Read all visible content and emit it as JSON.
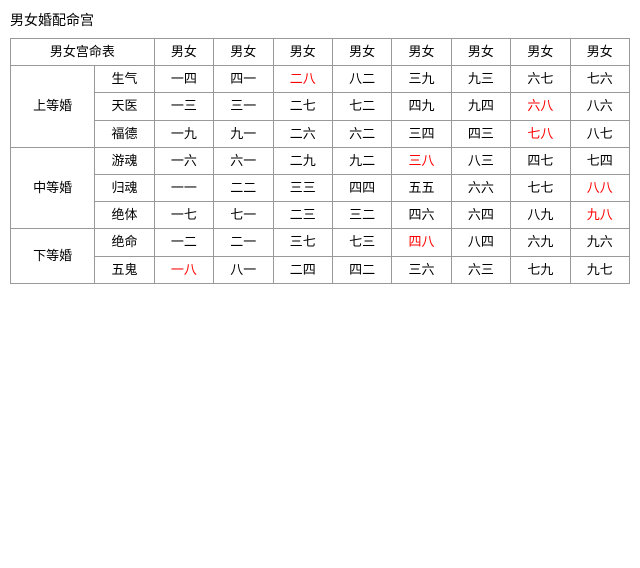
{
  "title": "男女婚配命宫",
  "header": {
    "col0": "男女宫命表",
    "cols": [
      "男女",
      "男女",
      "男女",
      "男女",
      "男女",
      "男女",
      "男女",
      "男女"
    ]
  },
  "groups": [
    {
      "grade": "上等婚",
      "rows": [
        {
          "subtype": "生气",
          "cells": [
            {
              "text": "一四",
              "red": false
            },
            {
              "text": "四一",
              "red": false
            },
            {
              "text": "二八",
              "red": true
            },
            {
              "text": "八二",
              "red": false
            },
            {
              "text": "三九",
              "red": false
            },
            {
              "text": "九三",
              "red": false
            },
            {
              "text": "六七",
              "red": false
            },
            {
              "text": "七六",
              "red": false
            }
          ]
        },
        {
          "subtype": "天医",
          "cells": [
            {
              "text": "一三",
              "red": false
            },
            {
              "text": "三一",
              "red": false
            },
            {
              "text": "二七",
              "red": false
            },
            {
              "text": "七二",
              "red": false
            },
            {
              "text": "四九",
              "red": false
            },
            {
              "text": "九四",
              "red": false
            },
            {
              "text": "六八",
              "red": true
            },
            {
              "text": "八六",
              "red": false
            }
          ]
        },
        {
          "subtype": "福德",
          "cells": [
            {
              "text": "一九",
              "red": false
            },
            {
              "text": "九一",
              "red": false
            },
            {
              "text": "二六",
              "red": false
            },
            {
              "text": "六二",
              "red": false
            },
            {
              "text": "三四",
              "red": false
            },
            {
              "text": "四三",
              "red": false
            },
            {
              "text": "七八",
              "red": true
            },
            {
              "text": "八七",
              "red": false
            }
          ]
        }
      ]
    },
    {
      "grade": "中等婚",
      "rows": [
        {
          "subtype": "游魂",
          "cells": [
            {
              "text": "一六",
              "red": false
            },
            {
              "text": "六一",
              "red": false
            },
            {
              "text": "二九",
              "red": false
            },
            {
              "text": "九二",
              "red": false
            },
            {
              "text": "三八",
              "red": true
            },
            {
              "text": "八三",
              "red": false
            },
            {
              "text": "四七",
              "red": false
            },
            {
              "text": "七四",
              "red": false
            }
          ]
        },
        {
          "subtype": "归魂",
          "cells": [
            {
              "text": "一一",
              "red": false
            },
            {
              "text": "二二",
              "red": false
            },
            {
              "text": "三三",
              "red": false
            },
            {
              "text": "四四",
              "red": false
            },
            {
              "text": "五五",
              "red": false
            },
            {
              "text": "六六",
              "red": false
            },
            {
              "text": "七七",
              "red": false
            },
            {
              "text": "八八",
              "red": true
            }
          ]
        },
        {
          "subtype": "绝体",
          "cells": [
            {
              "text": "一七",
              "red": false
            },
            {
              "text": "七一",
              "red": false
            },
            {
              "text": "二三",
              "red": false
            },
            {
              "text": "三二",
              "red": false
            },
            {
              "text": "四六",
              "red": false
            },
            {
              "text": "六四",
              "red": false
            },
            {
              "text": "八九",
              "red": false
            },
            {
              "text": "九八",
              "red": true
            }
          ]
        }
      ]
    },
    {
      "grade": "下等婚",
      "rows": [
        {
          "subtype": "绝命",
          "cells": [
            {
              "text": "一二",
              "red": false
            },
            {
              "text": "二一",
              "red": false
            },
            {
              "text": "三七",
              "red": false
            },
            {
              "text": "七三",
              "red": false
            },
            {
              "text": "四八",
              "red": true
            },
            {
              "text": "八四",
              "red": false
            },
            {
              "text": "六九",
              "red": false
            },
            {
              "text": "九六",
              "red": false
            }
          ]
        },
        {
          "subtype": "五鬼",
          "cells": [
            {
              "text": "一八",
              "red": true
            },
            {
              "text": "八一",
              "red": false
            },
            {
              "text": "二四",
              "red": false
            },
            {
              "text": "四二",
              "red": false
            },
            {
              "text": "三六",
              "red": false
            },
            {
              "text": "六三",
              "red": false
            },
            {
              "text": "七九",
              "red": false
            },
            {
              "text": "九七",
              "red": false
            }
          ]
        }
      ]
    }
  ]
}
